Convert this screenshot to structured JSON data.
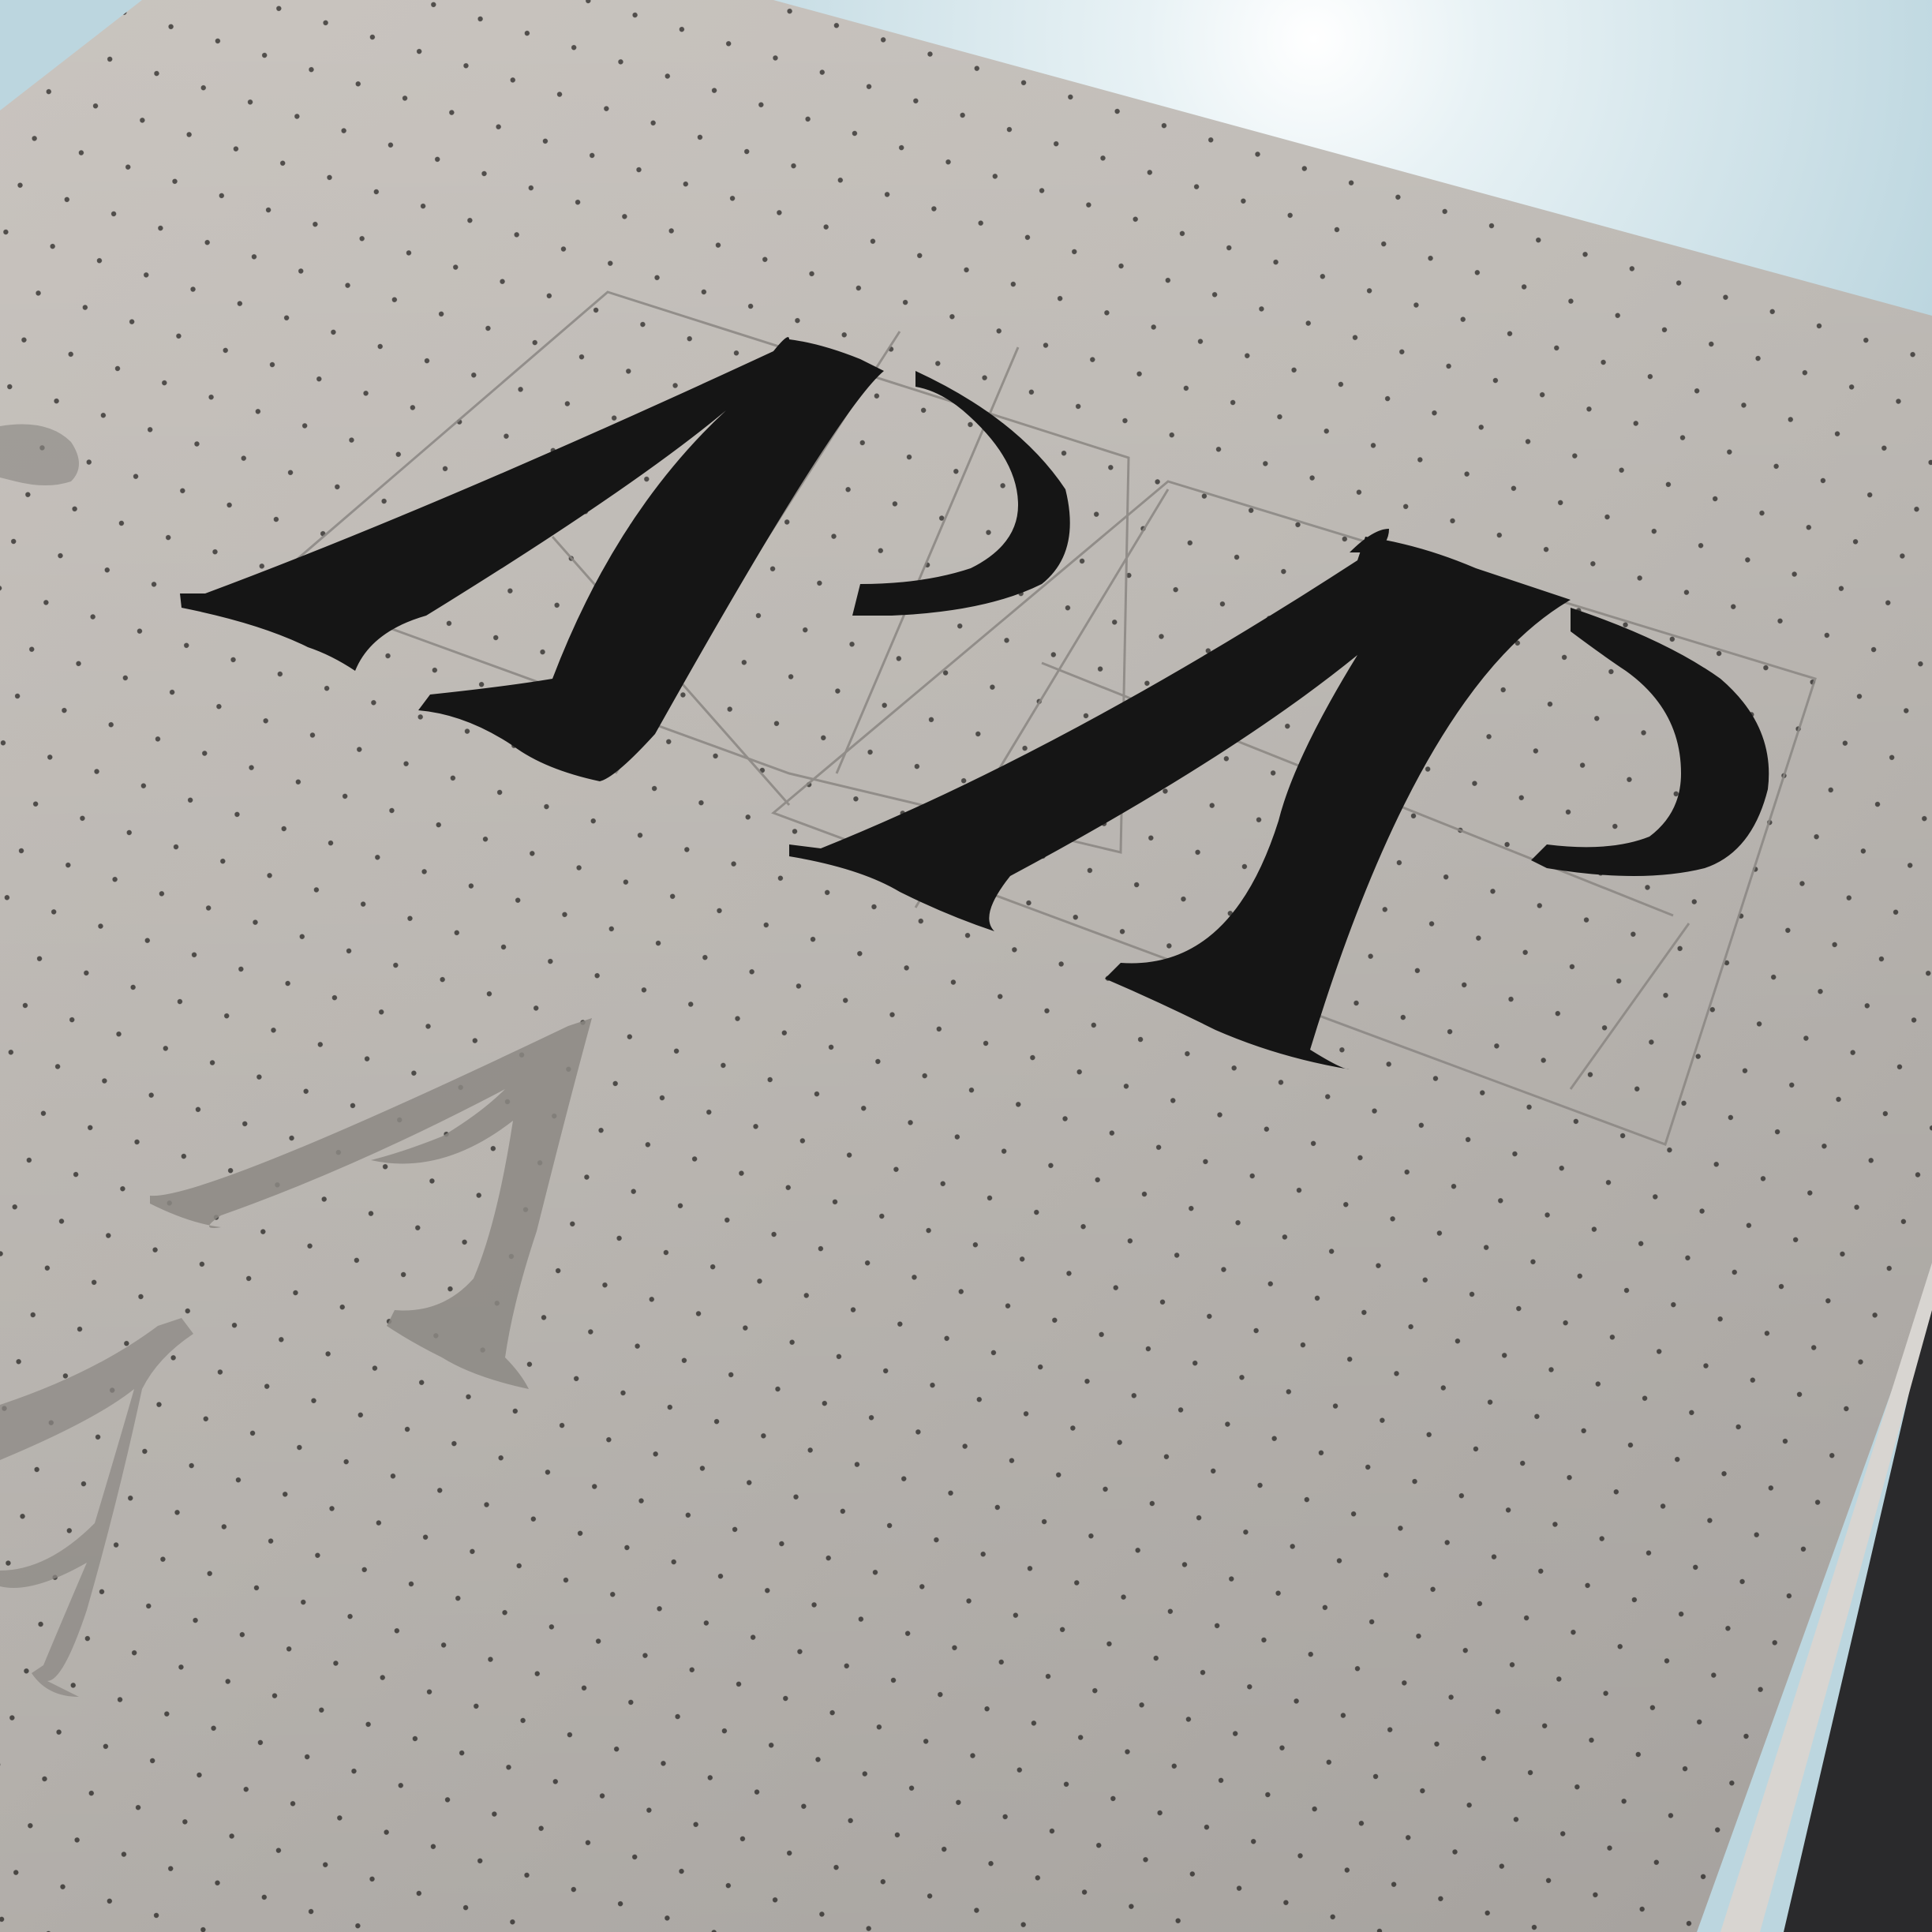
{
  "photo": {
    "subject": "",
    "surface_color": "#c4c0bb",
    "ink_color": "#151515",
    "pencil_color": "#8a8682",
    "sky_color": "#cfe3ea"
  },
  "ink_letters": [
    {
      "glyph": "A"
    },
    {
      "glyph": "P"
    },
    {
      "glyph": "A"
    },
    {
      "glyph": "P"
    }
  ],
  "pencil_letters": [
    {
      "glyph": "A"
    },
    {
      "glyph": "A"
    },
    {
      "glyph": "P"
    }
  ]
}
